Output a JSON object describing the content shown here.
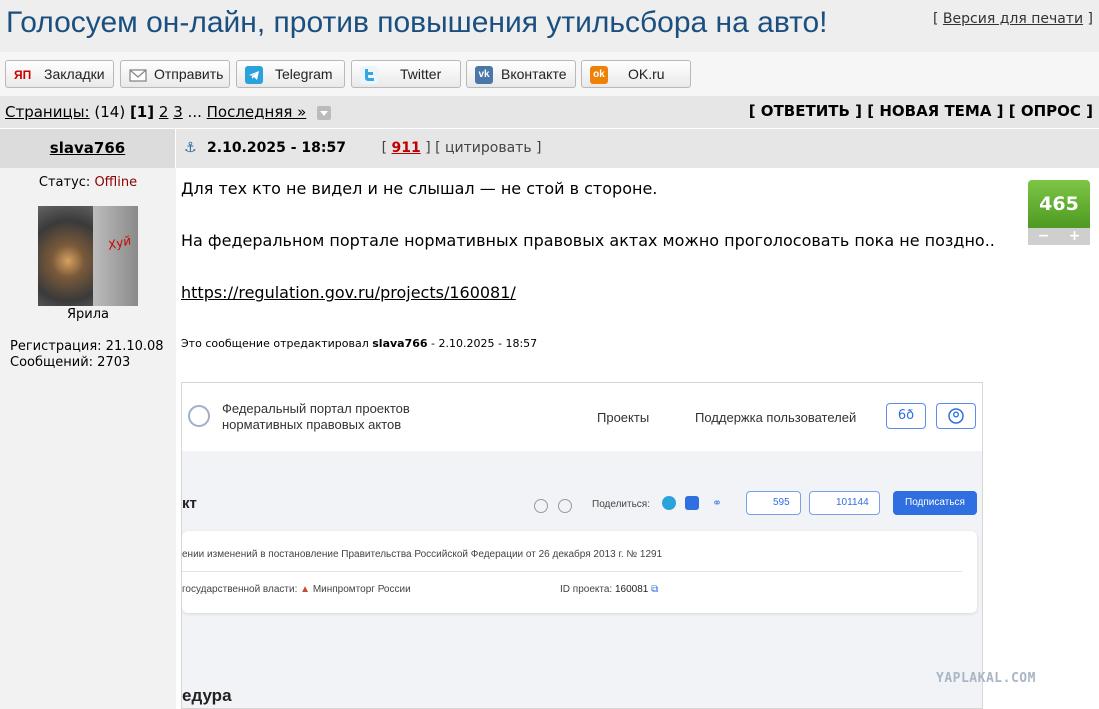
{
  "header": {
    "title": "Голосуем он-лайн, против повышения утильсбора на авто!",
    "print_open": "[",
    "print_label": "Версия для печати",
    "print_close": "]"
  },
  "share": [
    {
      "label": "Закладки",
      "icon": "yandex-bookmarks-icon",
      "icon_text": "ЯП",
      "color": "#cc0000"
    },
    {
      "label": "Отправить",
      "icon": "envelope-icon",
      "icon_text": "",
      "color": "#888888"
    },
    {
      "label": "Telegram",
      "icon": "telegram-icon",
      "icon_text": "",
      "color": "#2aa3dd"
    },
    {
      "label": "Twitter",
      "icon": "twitter-icon",
      "icon_text": "",
      "color": "#3aa4e0"
    },
    {
      "label": "Вконтакте",
      "icon": "vk-icon",
      "icon_text": "vk",
      "color": "#4a76a8"
    },
    {
      "label": "OK.ru",
      "icon": "odnoklassniki-icon",
      "icon_text": "ok",
      "color": "#ee8208"
    }
  ],
  "pagination": {
    "label": "Страницы:",
    "count": "(14)",
    "current": "[1]",
    "pages": [
      "2",
      "3"
    ],
    "ellipsis": "...",
    "last": "Последняя »"
  },
  "actions": {
    "reply": "[ ОТВЕТИТЬ ]",
    "new_topic": "[ НОВАЯ ТЕМА ]",
    "poll": "[ ОПРОС ]"
  },
  "post": {
    "author": "slava766",
    "anchor": "⚓",
    "date": "2.10.2025 - 18:57",
    "rating_open": "[",
    "rating": "911",
    "rating_close": "]",
    "quote": "[ цитировать ]",
    "lines": [
      "Для тех кто не видел и не слышал — не стой в стороне.",
      "На федеральном портале нормативных правовых актах можно проголосовать пока не поздно.."
    ],
    "link": "https://regulation.gov.ru/projects/160081/",
    "edited_prefix": "Это сообщение отредактировал",
    "edited_user": "slava766",
    "edited_date": "- 2.10.2025 - 18:57",
    "votes": "465",
    "vote_minus": "−",
    "vote_plus": "+"
  },
  "user": {
    "status_label": "Статус:",
    "status": "Offline",
    "avatar_text": "Хуй",
    "caption": "Ярила",
    "registration": "Регистрация: 21.10.08",
    "messages": "Сообщений: 2703"
  },
  "screenshot": {
    "portal_line1": "Федеральный портал проектов",
    "portal_line2": "нормативных правовых актов",
    "nav_projects": "Проекты",
    "nav_support": "Поддержка пользователей",
    "glasses_icon_text": "6ð",
    "heading": "кт",
    "share_label": "Поделиться:",
    "likes": "595",
    "dislikes": "101144",
    "subscribe": "Подписаться",
    "desc": "ении изменений в постановление Правительства Российской Федерации от 26 декабря 2013 г. № 1291",
    "authority_label": "государственной власти:",
    "authority": "Минпромторг России",
    "id_label": "ID проекта:",
    "id": "160081",
    "procedure": "едура"
  },
  "watermark": "YAPLAKAL.COM"
}
